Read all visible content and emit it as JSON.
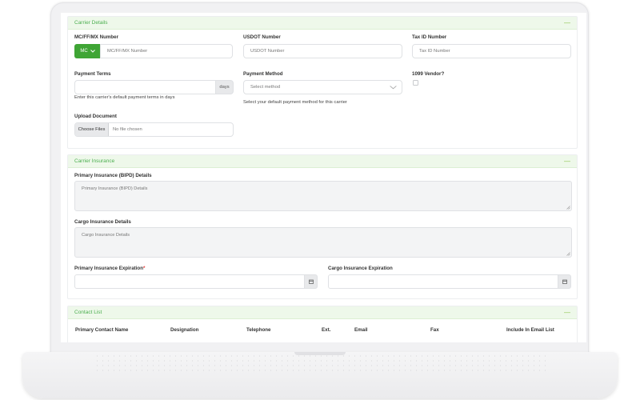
{
  "carrier_details": {
    "title": "Carrier Details",
    "collapse": "—",
    "mc_label": "MC/FF/MX Number",
    "mc_selected": "MC",
    "mc_placeholder": "MC/FF/MX Number",
    "usdot_label": "USDOT Number",
    "usdot_placeholder": "USDOT Number",
    "taxid_label": "Tax ID Number",
    "taxid_placeholder": "Tax ID Number",
    "payment_terms_label": "Payment Terms",
    "payment_terms_addon": "days",
    "payment_terms_help": "Enter this carrier's default payment terms in days",
    "payment_method_label": "Payment Method",
    "payment_method_placeholder": "Select method",
    "payment_method_help": "Select your default payment method for this carrier",
    "vendor_1099_label": "1099 Vendor?",
    "upload_label": "Upload Document",
    "choose_files": "Choose Files",
    "no_file": "No file chosen"
  },
  "carrier_insurance": {
    "title": "Carrier Insurance",
    "collapse": "—",
    "primary_label": "Primary Insurance (BIPD) Details",
    "primary_placeholder": "Primary Insurance (BIPD) Details",
    "cargo_label": "Cargo Insurance Details",
    "cargo_placeholder": "Cargo Insurance Details",
    "primary_exp_label": "Primary Insurance Expiration",
    "required_mark": "*",
    "cargo_exp_label": "Cargo Insurance Expiration"
  },
  "contact_list": {
    "title": "Contact List",
    "collapse": "—",
    "columns": [
      "Primary Contact Name",
      "Designation",
      "Telephone",
      "Ext.",
      "Email",
      "Fax",
      "Include In Email List"
    ]
  },
  "icons": {
    "calendar": "calendar-icon",
    "chevron": "chevron-down-icon"
  },
  "colors": {
    "accent": "#3fa535",
    "header_bg": "#eef8ea",
    "header_text": "#4caf50"
  }
}
